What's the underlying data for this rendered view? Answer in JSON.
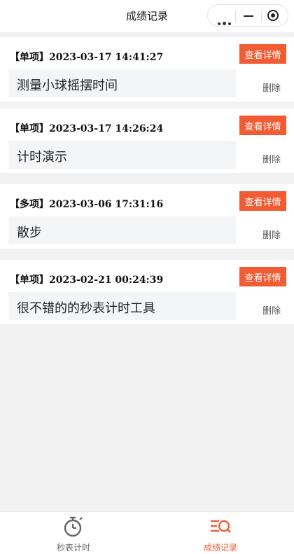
{
  "header": {
    "title": "成绩记录"
  },
  "records": [
    {
      "tag": "【单项】",
      "datetime": "2023-03-17 14:41:27",
      "note": "测量小球摇摆时间"
    },
    {
      "tag": "【单项】",
      "datetime": "2023-03-17 14:26:24",
      "note": "计时演示"
    },
    {
      "tag": "【多项】",
      "datetime": "2023-03-06 17:31:16",
      "note": "散步"
    },
    {
      "tag": "【单项】",
      "datetime": "2023-02-21 00:24:39",
      "note": "很不错的的秒表计时工具"
    }
  ],
  "actions": {
    "detail_label": "查看详情",
    "delete_label": "删除"
  },
  "tabbar": {
    "tabs": [
      {
        "label": "秒表计时",
        "icon": "stopwatch-icon",
        "active": false
      },
      {
        "label": "成绩记录",
        "icon": "records-search-icon",
        "active": true
      }
    ]
  },
  "colors": {
    "accent": "#f25c33",
    "tab_inactive": "#666666",
    "note_bg": "#f4f5f7"
  }
}
